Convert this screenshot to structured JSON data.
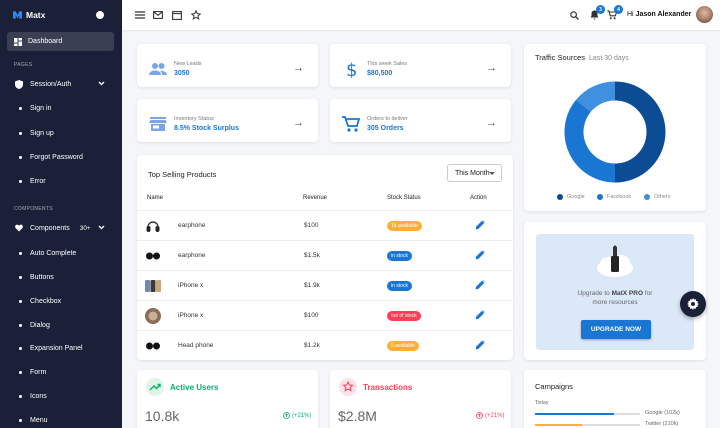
{
  "app": {
    "name": "Matx"
  },
  "sidebar": {
    "dashboard": "Dashboard",
    "sections": {
      "pages": "PAGES",
      "components": "COMPONENTS"
    },
    "session_auth": "Session/Auth",
    "auth_items": [
      "Sign in",
      "Sign up",
      "Forgot Password",
      "Error"
    ],
    "components": "Components",
    "components_badge": "30+",
    "component_items": [
      "Auto Complete",
      "Buttons",
      "Checkbox",
      "Dialog",
      "Expansion Panel",
      "Form",
      "Icons",
      "Menu"
    ]
  },
  "topbar": {
    "notifications_count": "3",
    "cart_count": "4",
    "greeting": "Hi",
    "user_name": "Jason Alexander"
  },
  "stats": [
    {
      "label": "New Leads",
      "value": "3050",
      "icon": "group-icon"
    },
    {
      "label": "This week Sales",
      "value": "$80,500",
      "icon": "dollar-icon"
    },
    {
      "label": "Inventory Status",
      "value": "8.5% Stock Surplus",
      "icon": "store-icon"
    },
    {
      "label": "Orders to deliver",
      "value": "305 Orders",
      "icon": "cart-icon"
    }
  ],
  "top_products": {
    "title": "Top Selling Products",
    "filter": "This Month",
    "columns": {
      "name": "Name",
      "revenue": "Revenue",
      "stock": "Stock Status",
      "action": "Action"
    },
    "rows": [
      {
        "name": "earphone",
        "revenue": "$100",
        "stock": "15 available",
        "stock_color": "#ffaf38"
      },
      {
        "name": "earphone",
        "revenue": "$1.5k",
        "stock": "in stock",
        "stock_color": "#1976d2"
      },
      {
        "name": "iPhone x",
        "revenue": "$1.9k",
        "stock": "in stock",
        "stock_color": "#1976d2"
      },
      {
        "name": "iPhone x",
        "revenue": "$100",
        "stock": "out of stock",
        "stock_color": "#ff3d57"
      },
      {
        "name": "Head phone",
        "revenue": "$1.2k",
        "stock": "5 available",
        "stock_color": "#ffaf38"
      }
    ]
  },
  "traffic": {
    "title": "Traffic Sources",
    "subtitle": "Last 30 days",
    "legend": [
      {
        "name": "Google",
        "color": "#0b4c94"
      },
      {
        "name": "Facebook",
        "color": "#1976d2"
      },
      {
        "name": "Others",
        "color": "#3f91e0"
      }
    ]
  },
  "chart_data": {
    "type": "pie",
    "title": "Traffic Sources",
    "subtitle": "Last 30 days",
    "categories": [
      "Google",
      "Facebook",
      "Others"
    ],
    "values": [
      50,
      36,
      14
    ],
    "colors": [
      "#0b4c94",
      "#1976d2",
      "#3f91e0"
    ],
    "legend_position": "bottom"
  },
  "promo": {
    "text_before": "Upgrade to",
    "brand": "MatX PRO",
    "text_after": "for",
    "line2": "more resources",
    "button": "UPGRADE NOW"
  },
  "active_users": {
    "title": "Active Users",
    "value": "10.8k",
    "change": "(+21%)"
  },
  "transactions": {
    "title": "Transactions",
    "value": "$2.8M",
    "change": "(+21%)"
  },
  "campaigns": {
    "title": "Campaigns",
    "period": "Today",
    "items": [
      {
        "label": "Google (102k)",
        "fraction": 0.75,
        "color": "#1976d2"
      },
      {
        "label": "Twitter (210k)",
        "fraction": 0.45,
        "color": "#ffaf38"
      }
    ]
  }
}
